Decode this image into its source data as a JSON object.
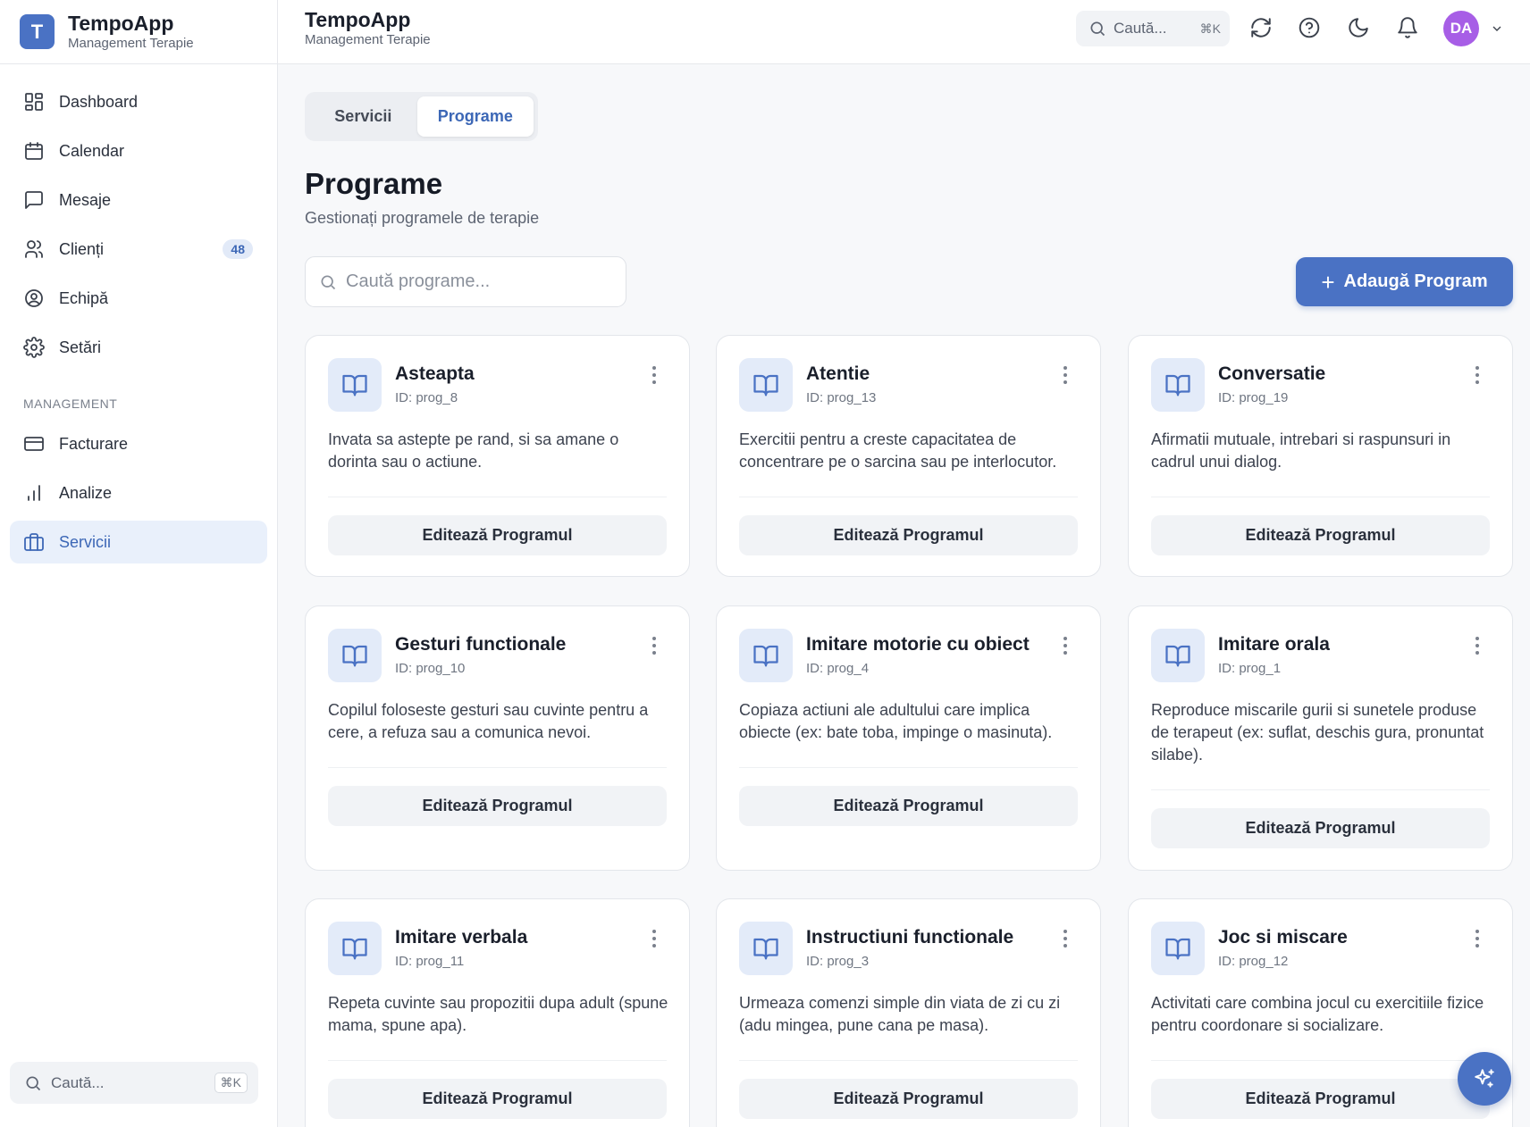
{
  "sidebar": {
    "logo_letter": "T",
    "brand_title": "TempoApp",
    "brand_subtitle": "Management Terapie",
    "nav": [
      {
        "label": "Dashboard",
        "icon": "dashboard-icon"
      },
      {
        "label": "Calendar",
        "icon": "calendar-icon"
      },
      {
        "label": "Mesaje",
        "icon": "message-icon"
      },
      {
        "label": "Clienți",
        "icon": "users-icon",
        "badge": "48"
      },
      {
        "label": "Echipă",
        "icon": "user-circle-icon"
      },
      {
        "label": "Setări",
        "icon": "gear-icon"
      }
    ],
    "section_label": "MANAGEMENT",
    "management": [
      {
        "label": "Facturare",
        "icon": "credit-card-icon"
      },
      {
        "label": "Analize",
        "icon": "bar-chart-icon"
      },
      {
        "label": "Servicii",
        "icon": "briefcase-icon",
        "active": true
      }
    ],
    "search_label": "Caută...",
    "search_shortcut": "⌘K"
  },
  "header": {
    "title": "TempoApp",
    "subtitle": "Management Terapie",
    "search_label": "Caută...",
    "search_shortcut": "⌘K",
    "avatar_initials": "DA",
    "avatar_color": "#a75ee6"
  },
  "tabs": [
    {
      "label": "Servicii",
      "active": false
    },
    {
      "label": "Programe",
      "active": true
    }
  ],
  "page": {
    "title": "Programe",
    "subtitle": "Gestionați programele de terapie",
    "search_placeholder": "Caută programe...",
    "add_button": "Adaugă Program",
    "accent": "#4a72c4"
  },
  "programs": [
    {
      "title": "Asteapta",
      "id": "ID: prog_8",
      "description": "Invata sa astepte pe rand, si sa amane o dorinta sau o actiune.",
      "button": "Editează Programul"
    },
    {
      "title": "Atentie",
      "id": "ID: prog_13",
      "description": "Exercitii pentru a creste capacitatea de concentrare pe o sarcina sau pe interlocutor.",
      "button": "Editează Programul"
    },
    {
      "title": "Conversatie",
      "id": "ID: prog_19",
      "description": "Afirmatii mutuale, intrebari si raspunsuri in cadrul unui dialog.",
      "button": "Editează Programul"
    },
    {
      "title": "Gesturi functionale",
      "id": "ID: prog_10",
      "description": "Copilul foloseste gesturi sau cuvinte pentru a cere, a refuza sau a comunica nevoi.",
      "button": "Editează Programul"
    },
    {
      "title": "Imitare motorie cu obiect",
      "id": "ID: prog_4",
      "description": "Copiaza actiuni ale adultului care implica obiecte (ex: bate toba, impinge o masinuta).",
      "button": "Editează Programul"
    },
    {
      "title": "Imitare orala",
      "id": "ID: prog_1",
      "description": "Reproduce miscarile gurii si sunetele produse de terapeut (ex: suflat, deschis gura, pronuntat silabe).",
      "button": "Editează Programul"
    },
    {
      "title": "Imitare verbala",
      "id": "ID: prog_11",
      "description": "Repeta cuvinte sau propozitii dupa adult (spune mama, spune apa).",
      "button": "Editează Programul"
    },
    {
      "title": "Instructiuni functionale",
      "id": "ID: prog_3",
      "description": "Urmeaza comenzi simple din viata de zi cu zi (adu mingea, pune cana pe masa).",
      "button": "Editează Programul"
    },
    {
      "title": "Joc si miscare",
      "id": "ID: prog_12",
      "description": "Activitati care combina jocul cu exercitiile fizice pentru coordonare si socializare.",
      "button": "Editează Programul"
    }
  ]
}
